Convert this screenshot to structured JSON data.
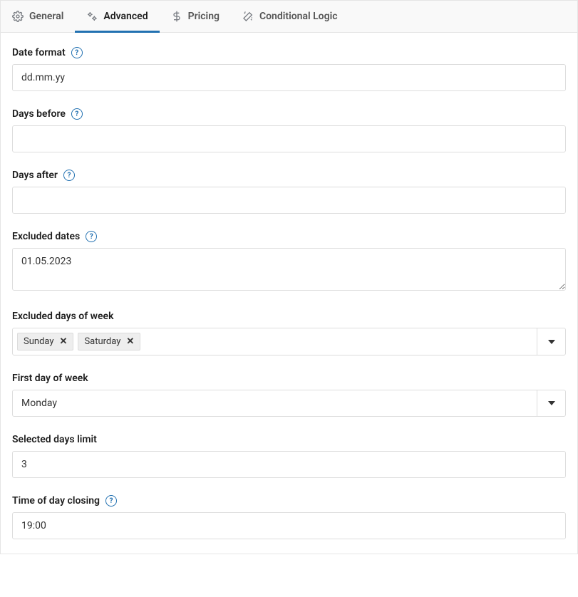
{
  "tabs": {
    "general": "General",
    "advanced": "Advanced",
    "pricing": "Pricing",
    "conditional": "Conditional Logic"
  },
  "fields": {
    "date_format": {
      "label": "Date format",
      "value": "dd.mm.yy"
    },
    "days_before": {
      "label": "Days before",
      "value": ""
    },
    "days_after": {
      "label": "Days after",
      "value": ""
    },
    "excluded_dates": {
      "label": "Excluded dates",
      "value": "01.05.2023"
    },
    "excluded_days_of_week": {
      "label": "Excluded days of week",
      "tags": [
        "Sunday",
        "Saturday"
      ]
    },
    "first_day_of_week": {
      "label": "First day of week",
      "value": "Monday"
    },
    "selected_days_limit": {
      "label": "Selected days limit",
      "value": "3"
    },
    "time_of_day_closing": {
      "label": "Time of day closing",
      "value": "19:00"
    }
  }
}
